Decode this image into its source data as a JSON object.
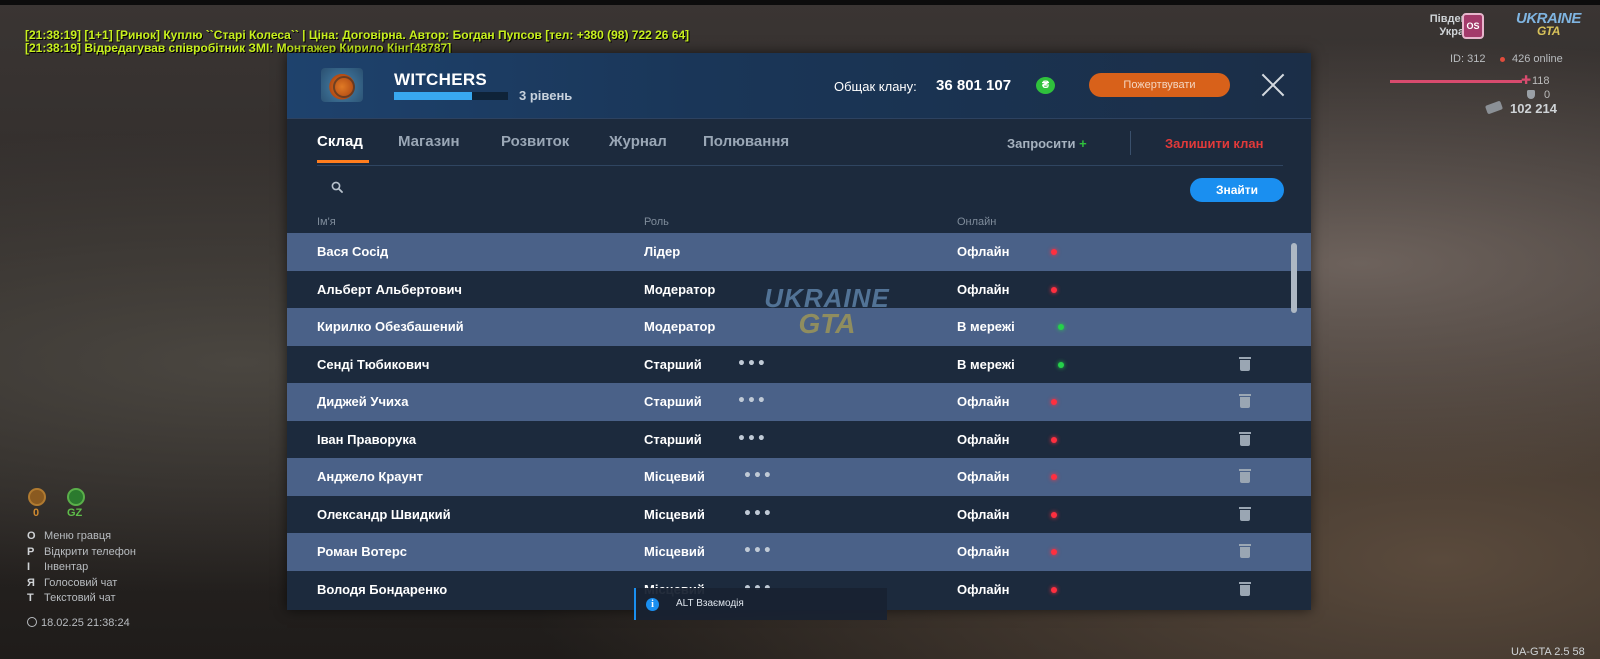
{
  "chat": {
    "lines": [
      "[21:38:19] [1+1] [Ринок] Куплю ``Старі Колеса`` | Ціна: Договірна. Автор: Богдан Пупсов [тел: +380 (98) 722 26 64]",
      "[21:38:19]  Відредагував співробітник ЗМІ: Монтажер Кирило Кінг[48787]"
    ]
  },
  "hud": {
    "region_line1": "Південна",
    "region_line2": "Україна",
    "region_emblem": "OS",
    "logo_line1": "UKRAINE",
    "logo_line2": "GTA",
    "id": "ID: 312",
    "online": "426 online",
    "hp": "118",
    "armor": "0",
    "money": "102 214",
    "food_value": "0",
    "health_label": "GZ",
    "keys": [
      {
        "key": "O",
        "label": "Меню гравця"
      },
      {
        "key": "P",
        "label": "Відкрити телефон"
      },
      {
        "key": "I",
        "label": "Інвентар"
      },
      {
        "key": "Я",
        "label": "Голосовий чат"
      },
      {
        "key": "T",
        "label": "Текстовий чат"
      }
    ],
    "datetime": "18.02.25 21:38:24",
    "version": "UA-GTA 2.5",
    "version_extra": "58"
  },
  "clan": {
    "name": "WITCHERS",
    "level_text": "3 рівень",
    "level_progress": 0.68,
    "bank_label": "Общак клану:",
    "bank_value": "36 801 107",
    "currency_symbol": "₴",
    "donate_label": "Пожертвувати"
  },
  "tabs": [
    {
      "label": "Склад",
      "active": true
    },
    {
      "label": "Магазин",
      "active": false
    },
    {
      "label": "Розвиток",
      "active": false
    },
    {
      "label": "Журнал",
      "active": false
    },
    {
      "label": "Полювання",
      "active": false
    }
  ],
  "actions": {
    "invite_label": "Запросити",
    "invite_plus": "+",
    "leave_label": "Залишити клан"
  },
  "search": {
    "placeholder": "",
    "value": "",
    "button_label": "Знайти"
  },
  "columns": {
    "name": "Ім'я",
    "role": "Роль",
    "online": "Онлайн"
  },
  "members": [
    {
      "name": "Вася Сосід",
      "role": "Лідер",
      "status": "Офлайн",
      "online": false,
      "menu": false,
      "delete": false
    },
    {
      "name": "Альберт Альбертович",
      "role": "Модератор",
      "status": "Офлайн",
      "online": false,
      "menu": false,
      "delete": false
    },
    {
      "name": "Кирилко Обезбашений",
      "role": "Модератор",
      "status": "В мережі",
      "online": true,
      "menu": false,
      "delete": false
    },
    {
      "name": "Сенді Тюбикович",
      "role": "Старший",
      "status": "В мережі",
      "online": true,
      "menu": true,
      "delete": true
    },
    {
      "name": "Диджей Учиха",
      "role": "Старший",
      "status": "Офлайн",
      "online": false,
      "menu": true,
      "delete": true
    },
    {
      "name": "Іван Праворука",
      "role": "Старший",
      "status": "Офлайн",
      "online": false,
      "menu": true,
      "delete": true
    },
    {
      "name": "Анджело Краунт",
      "role": "Місцевий",
      "status": "Офлайн",
      "online": false,
      "menu": true,
      "delete": true
    },
    {
      "name": "Олександр Швидкий",
      "role": "Місцевий",
      "status": "Офлайн",
      "online": false,
      "menu": true,
      "delete": true
    },
    {
      "name": "Роман Вотерс",
      "role": "Місцевий",
      "status": "Офлайн",
      "online": false,
      "menu": true,
      "delete": true
    },
    {
      "name": "Володя Бондаренко",
      "role": "Місцевий",
      "status": "Офлайн",
      "online": false,
      "menu": true,
      "delete": true
    }
  ],
  "watermark": {
    "line1": "UKRAINE",
    "line2": "GTA"
  },
  "tooltip": {
    "icon": "i",
    "text": "ALT Взаємодія"
  }
}
